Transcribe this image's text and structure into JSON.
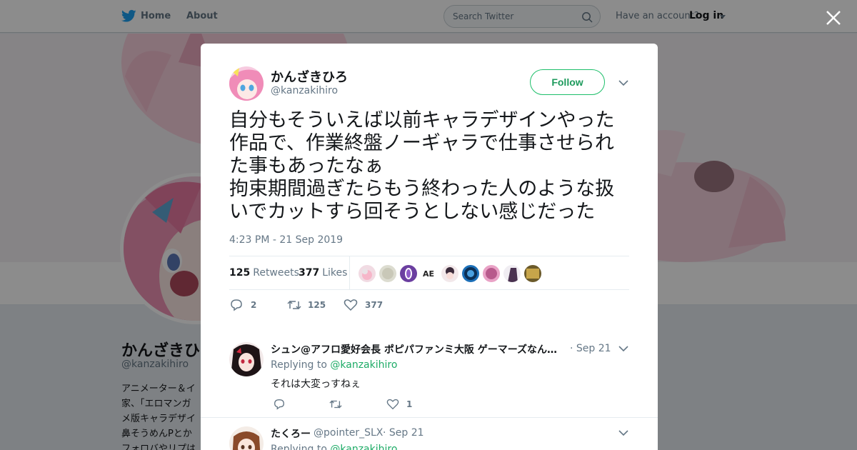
{
  "topnav": {
    "home_label": "Home",
    "about_label": "About",
    "search_placeholder": "Search Twitter",
    "account_prompt": "Have an account?",
    "login_label": "Log in"
  },
  "background_profile": {
    "name": "かんざきひ",
    "handle": "@kanzakihiro",
    "bio_lines": [
      "アニメーター＆イ",
      "家、「エロマンガ",
      "メ版キャラデザイ",
      "鼻そうめんPとか",
      "フォロバやリプは"
    ]
  },
  "tweet": {
    "author_name": "かんざきひろ",
    "author_handle": "@kanzakihiro",
    "follow_label": "Follow",
    "text": "自分もそういえば以前キャラデザインやった作品で、作業終盤ノーギャラで仕事させられた事もあったなぁ\n拘束期間過ぎたらもう終わった人のような扱いでカットすら回そうとしない感じだった",
    "timestamp": "4:23 PM - 21 Sep 2019",
    "retweet_count": "125",
    "retweet_label": "Retweets",
    "like_count": "377",
    "like_label": "Likes",
    "reply_action_count": "2",
    "retweet_action_count": "125",
    "like_action_count": "377"
  },
  "replies": [
    {
      "name": "シュン@アフロ愛好会長 ポピパファンミ大阪 ゲーマーズなん…",
      "date": "· Sep 21",
      "replying_prefix": "Replying to",
      "replying_to": "@kanzakihiro",
      "text": "それは大変っすねぇ",
      "like_count": "1"
    },
    {
      "name": "たくろー",
      "handle": "@pointer_SLX",
      "date": "· Sep 21",
      "replying_prefix": "Replying to",
      "replying_to": "@kanzakihiro"
    }
  ],
  "colors": {
    "twitter_blue": "#1da1f2",
    "follow_green": "#1dbf6a",
    "link_green": "#1dab66"
  }
}
